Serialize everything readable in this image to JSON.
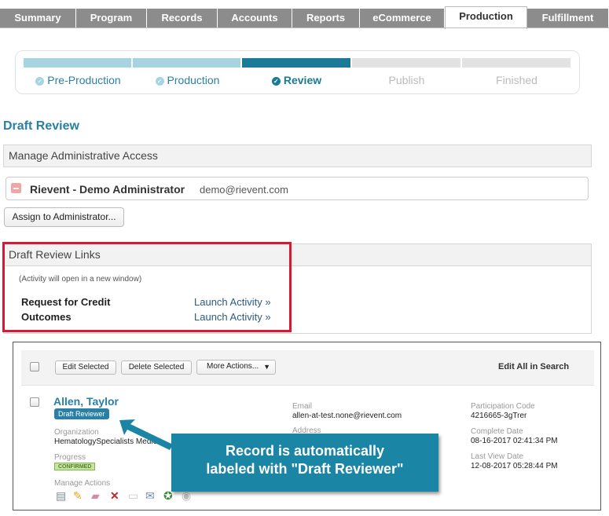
{
  "tabs": [
    "Summary",
    "Program",
    "Records",
    "Accounts",
    "Reports",
    "eCommerce",
    "Production",
    "Fulfillment"
  ],
  "active_tab": "Production",
  "wizard": {
    "steps": [
      {
        "label": "Pre-Production",
        "state": "done"
      },
      {
        "label": "Production",
        "state": "done"
      },
      {
        "label": "Review",
        "state": "current"
      },
      {
        "label": "Publish",
        "state": "pending"
      },
      {
        "label": "Finished",
        "state": "pending"
      }
    ]
  },
  "colors": {
    "done": "#a6d4e0",
    "current": "#1a7a98",
    "pending": "#e2e2e2",
    "accent": "#2a7fa5",
    "highlight": "#d51a35"
  },
  "page_title": "Draft Review",
  "admin_section": {
    "title": "Manage Administrative Access",
    "admin_name": "Rievent - Demo Administrator",
    "admin_email": "demo@rievent.com",
    "assign_button": "Assign to Administrator..."
  },
  "links_section": {
    "title": "Draft Review Links",
    "note": "(Activity will open in a new window)",
    "links": [
      {
        "name": "Request for Credit",
        "action": "Launch Activity »"
      },
      {
        "name": "Outcomes",
        "action": "Launch Activity »"
      }
    ]
  },
  "records": {
    "edit_selected": "Edit Selected",
    "delete_selected": "Delete Selected",
    "more_actions": "More Actions...",
    "edit_all": "Edit All in Search",
    "record": {
      "name": "Allen, Taylor",
      "badge": "Draft Reviewer",
      "organization_label": "Organization",
      "organization": "HematologySpecialists Medica",
      "progress_label": "Progress",
      "progress": "CONFIRMED",
      "manage_label": "Manage Actions",
      "email_label": "Email",
      "email": "allen-at-test.none@rievent.com",
      "address_label": "Address",
      "participation_label": "Participation Code",
      "participation_code": "4216665-3gTrer",
      "complete_label": "Complete Date",
      "complete_date": "08-16-2017 02:41:34 PM",
      "last_view_label": "Last View Date",
      "last_view_date": "12-08-2017 05:28:44 PM"
    }
  },
  "callout": {
    "line1": "Record is automatically",
    "line2": "labeled with \"Draft Reviewer\""
  }
}
